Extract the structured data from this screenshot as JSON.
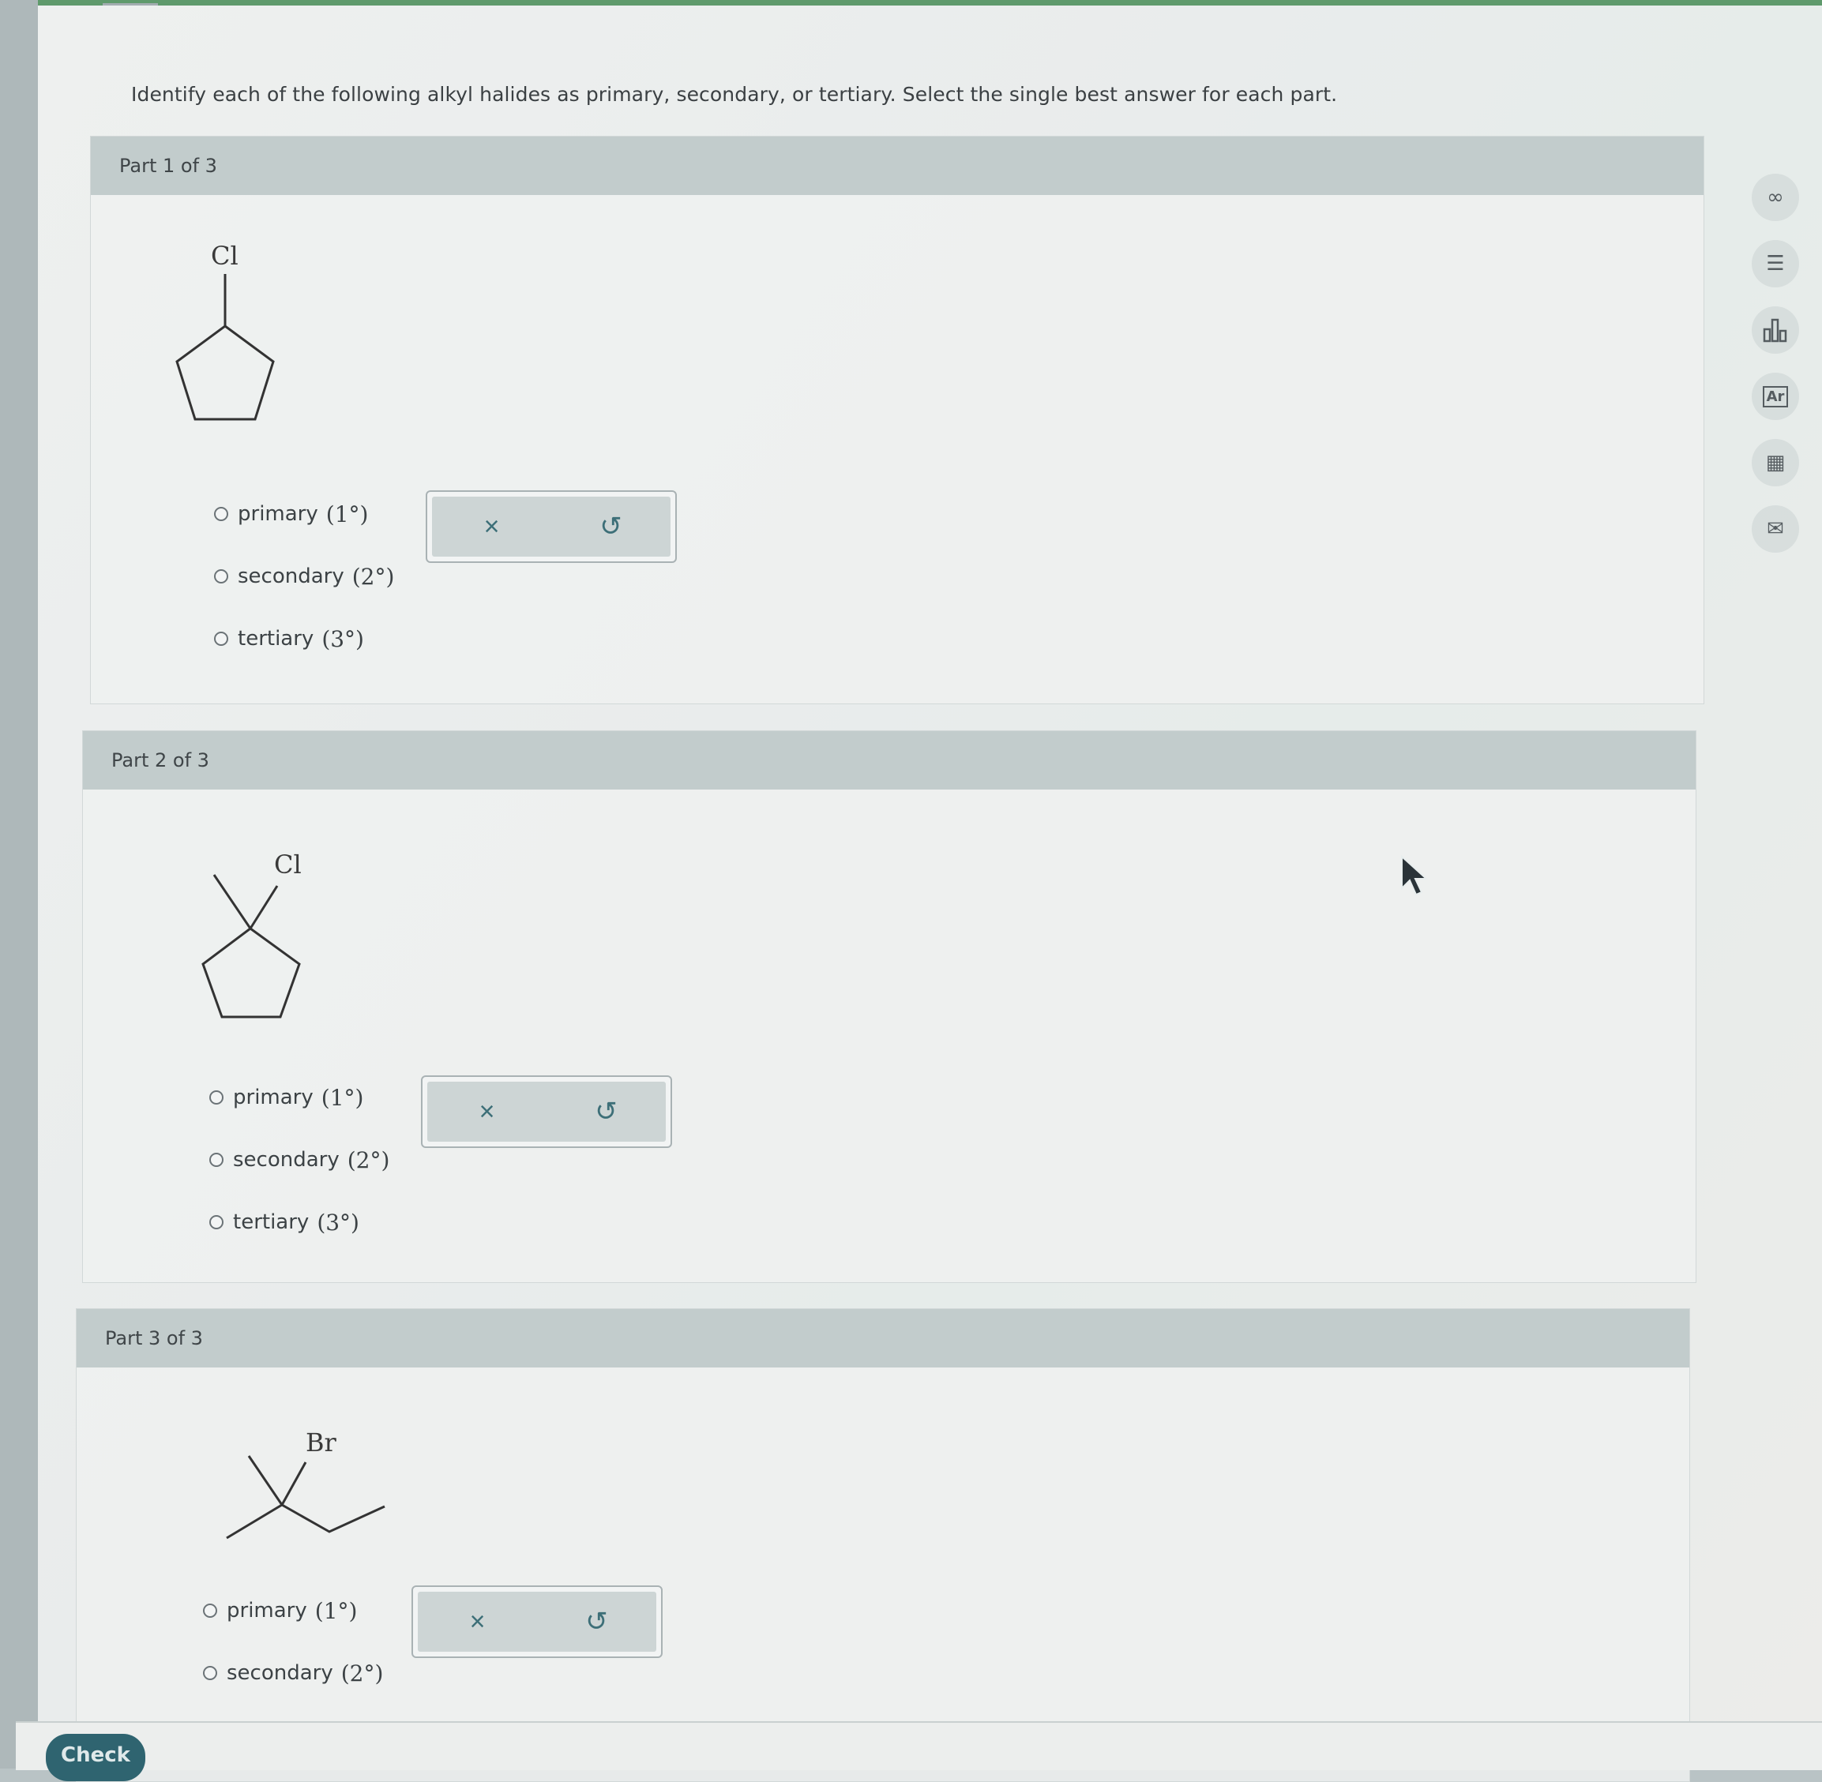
{
  "instruction": "Identify each of the following alkyl halides as primary, secondary, or tertiary. Select the single best answer for each part.",
  "parts": [
    {
      "header": "Part 1 of 3",
      "molecule": {
        "name": "chlorocyclopentane",
        "substituent": "Cl"
      },
      "options": [
        {
          "label": "primary",
          "degree": "(1°)",
          "selected": false
        },
        {
          "label": "secondary",
          "degree": "(2°)",
          "selected": false
        },
        {
          "label": "tertiary",
          "degree": "(3°)",
          "selected": false
        }
      ],
      "actions": {
        "clear": "×",
        "undo": "↺"
      }
    },
    {
      "header": "Part 2 of 3",
      "molecule": {
        "name": "1-chloro-1-methylcyclopentane",
        "substituent": "Cl"
      },
      "options": [
        {
          "label": "primary",
          "degree": "(1°)",
          "selected": false
        },
        {
          "label": "secondary",
          "degree": "(2°)",
          "selected": false
        },
        {
          "label": "tertiary",
          "degree": "(3°)",
          "selected": false
        }
      ],
      "actions": {
        "clear": "×",
        "undo": "↺"
      }
    },
    {
      "header": "Part 3 of 3",
      "molecule": {
        "name": "2-bromo-2-methylbutane",
        "substituent": "Br"
      },
      "options": [
        {
          "label": "primary",
          "degree": "(1°)",
          "selected": false
        },
        {
          "label": "secondary",
          "degree": "(2°)",
          "selected": false
        }
      ],
      "actions": {
        "clear": "×",
        "undo": "↺"
      }
    }
  ],
  "tools": [
    {
      "name": "infinity-icon",
      "glyph": "∞"
    },
    {
      "name": "notes-icon",
      "glyph": "☰"
    },
    {
      "name": "bar-chart-icon",
      "glyph": "▮"
    },
    {
      "name": "periodic-table-icon",
      "glyph": "Ar"
    },
    {
      "name": "calculator-icon",
      "glyph": "▦"
    },
    {
      "name": "mail-icon",
      "glyph": "✉"
    }
  ],
  "footer": {
    "check_label": "Check"
  },
  "colors": {
    "accent": "#2f6470",
    "topbar": "#5f9a6c",
    "header_bg": "#c2cccc",
    "icon_teal": "#3d6f78"
  }
}
